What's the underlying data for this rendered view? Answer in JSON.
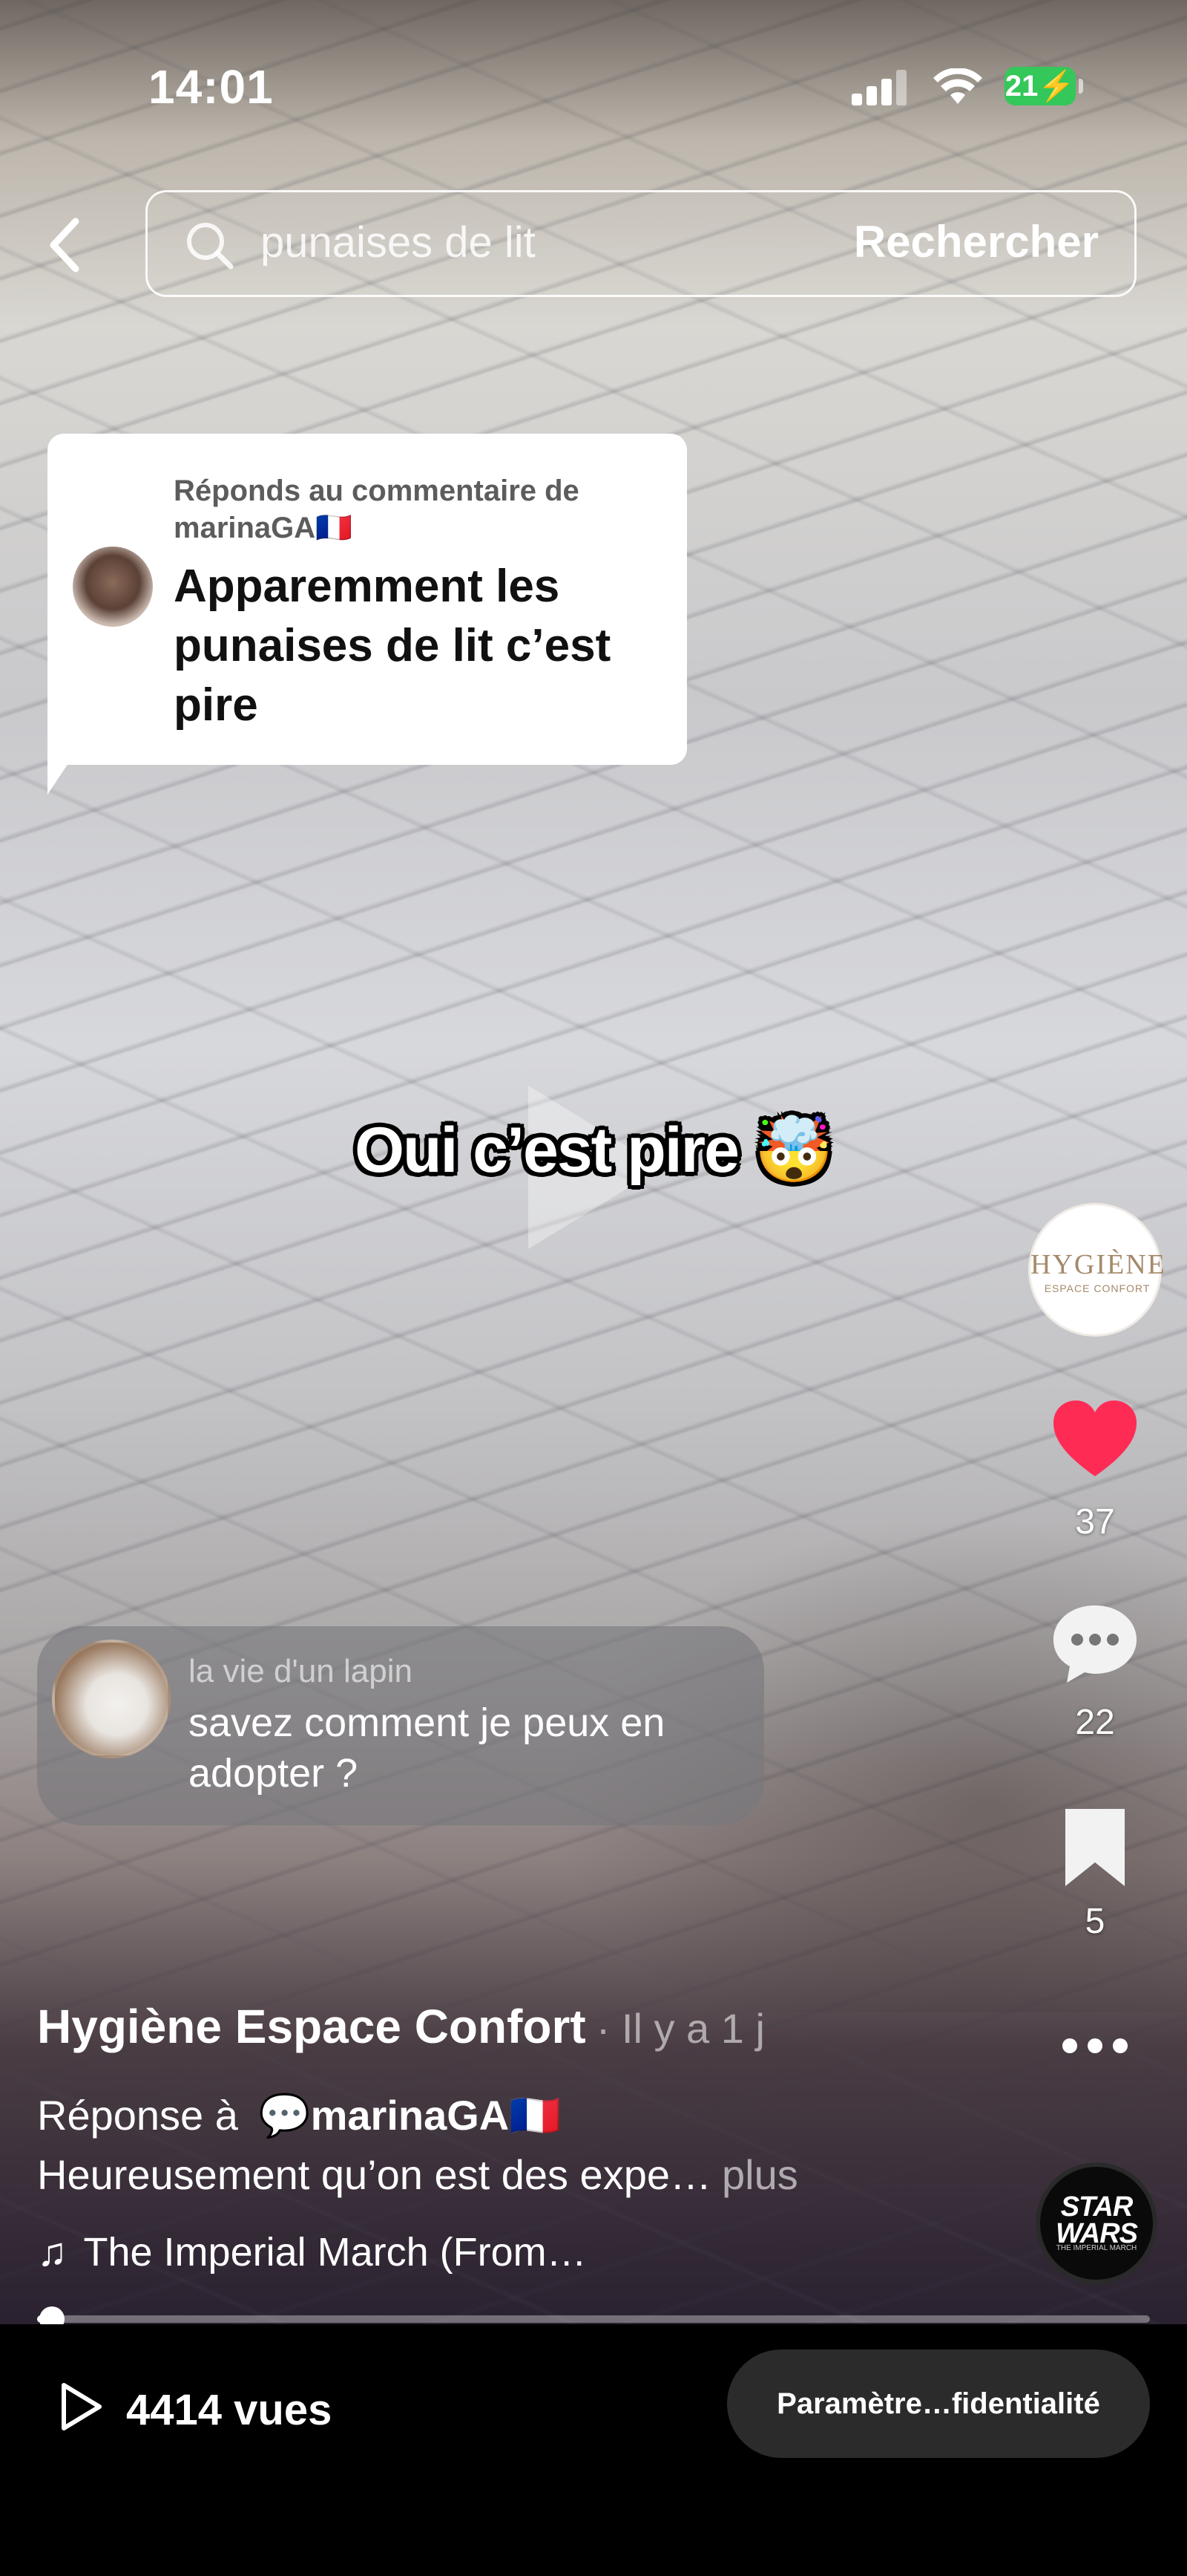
{
  "status_bar": {
    "time": "14:01",
    "battery": "21"
  },
  "search": {
    "query": "punaises de lit",
    "button_label": "Rechercher"
  },
  "reply_card": {
    "prefix": "Réponds au commentaire de",
    "user": "marinaGA🇫🇷",
    "text": "Apparemment les punaises de lit c’est pire"
  },
  "video": {
    "caption": "Oui c’est pire 🤯"
  },
  "profile": {
    "logo_main": "HYGIÈNE",
    "logo_sub": "ESPACE CONFORT"
  },
  "actions": {
    "likes": "37",
    "comments": "22",
    "saves": "5"
  },
  "comment": {
    "user": "la vie d'un lapin",
    "text": "savez comment je peux en adopter ?"
  },
  "post": {
    "author": "Hygiène Espace Confort",
    "time": "· Il y a 1 j",
    "reply_prefix": "Réponse à",
    "reply_mention": "marinaGA🇫🇷",
    "description": "Heureusement qu’on est des expe…",
    "more_label": "plus",
    "music": "The Imperial March (From…",
    "music_disc_title": "STAR WARS",
    "music_disc_sub": "THE IMPERIAL MARCH"
  },
  "progress": {
    "fraction": 0.01
  },
  "bottom": {
    "views": "4414 vues",
    "privacy_button": "Paramètre…fidentialité"
  },
  "colors": {
    "like": "#fe2c55",
    "battery": "#34c759"
  }
}
